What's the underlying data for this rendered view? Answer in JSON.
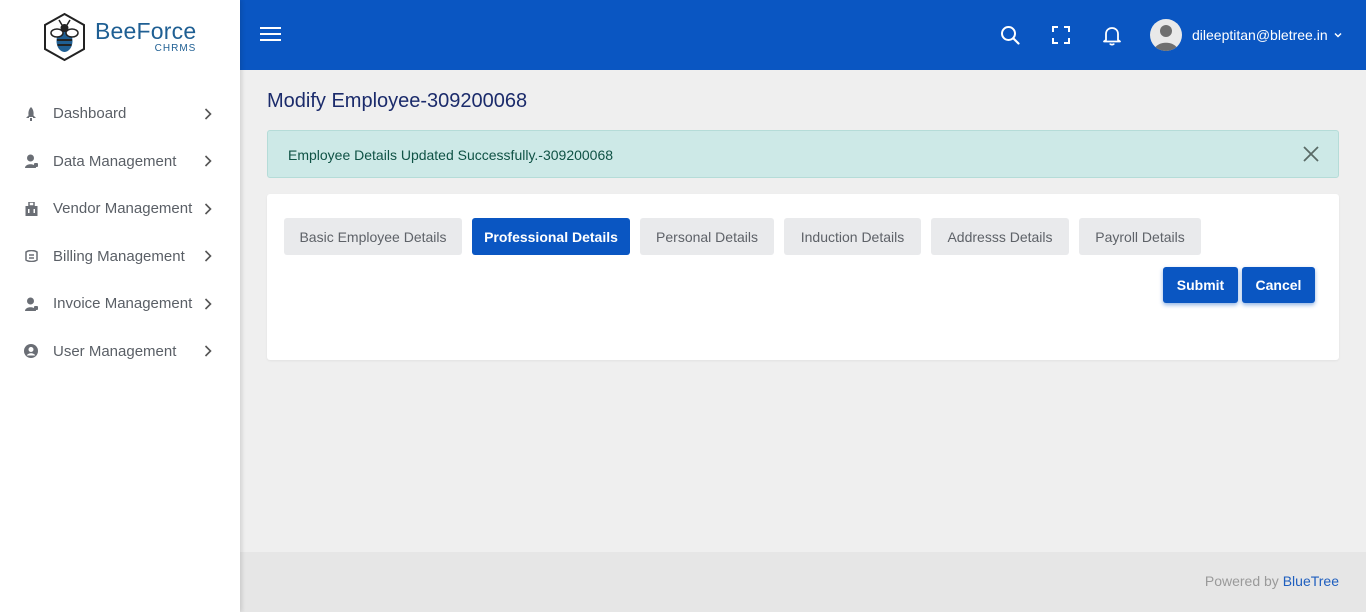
{
  "brand": {
    "name": "BeeForce",
    "sub": "CHRMS"
  },
  "colors": {
    "primary": "#0a56c2",
    "alert_bg": "#cde9e7",
    "alert_text": "#0f5245",
    "title": "#1b2b6b"
  },
  "sidebar": {
    "items": [
      {
        "label": "Dashboard",
        "icon": "rocket-icon"
      },
      {
        "label": "Data Management",
        "icon": "user-icon"
      },
      {
        "label": "Vendor Management",
        "icon": "building-icon"
      },
      {
        "label": "Billing Management",
        "icon": "billing-icon"
      },
      {
        "label": "Invoice Management",
        "icon": "user-icon"
      },
      {
        "label": "User Management",
        "icon": "user-circle-icon"
      }
    ]
  },
  "header": {
    "user_email": "dileeptitan@bletree.in"
  },
  "page": {
    "title": "Modify Employee-309200068"
  },
  "alert": {
    "message": "Employee Details Updated Successfully.-309200068"
  },
  "tabs": [
    {
      "label": "Basic Employee Details",
      "active": false
    },
    {
      "label": "Professional Details",
      "active": true
    },
    {
      "label": "Personal Details",
      "active": false
    },
    {
      "label": "Induction Details",
      "active": false
    },
    {
      "label": "Addresss Details",
      "active": false
    },
    {
      "label": "Payroll Details",
      "active": false
    }
  ],
  "actions": {
    "submit": "Submit",
    "cancel": "Cancel"
  },
  "footer": {
    "prefix": "Powered by ",
    "link": "BlueTree"
  }
}
